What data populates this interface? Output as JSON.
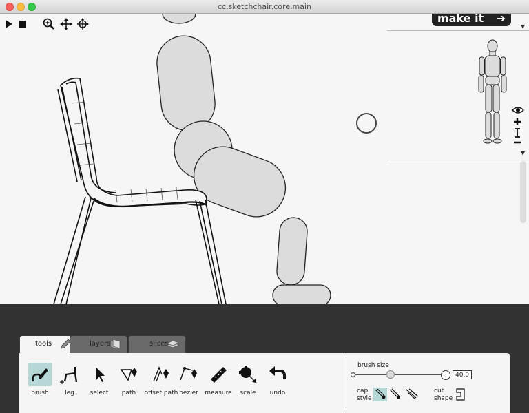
{
  "window": {
    "title": "cc.sketchchair.core.main"
  },
  "toolbar": {
    "play_icon": "play-icon",
    "stop_icon": "stop-icon",
    "zoom_icon": "zoom-icon",
    "pan_icon": "move-icon",
    "rotate_icon": "rotate-icon",
    "make_it_label": "make it",
    "make_it_arrow": "➔"
  },
  "tabs": [
    {
      "label": "tools",
      "icon": "pencil-icon",
      "active": true
    },
    {
      "label": "layers",
      "icon": "layers-icon",
      "active": false
    },
    {
      "label": "slices",
      "icon": "slices-icon",
      "active": false
    }
  ],
  "tools": [
    {
      "label": "brush",
      "icon": "brush-icon",
      "active": true
    },
    {
      "label": "leg",
      "icon": "leg-icon",
      "active": false
    },
    {
      "label": "select",
      "icon": "select-icon",
      "active": false
    },
    {
      "label": "path",
      "icon": "path-icon",
      "active": false
    },
    {
      "label": "offset path",
      "icon": "offset-path-icon",
      "active": false
    },
    {
      "label": "bezier",
      "icon": "bezier-icon",
      "active": false
    },
    {
      "label": "measure",
      "icon": "measure-icon",
      "active": false
    },
    {
      "label": "scale",
      "icon": "scale-icon",
      "active": false
    },
    {
      "label": "undo",
      "icon": "undo-icon",
      "active": false
    }
  ],
  "brush": {
    "size_label": "brush size",
    "size_value": "40.0",
    "size_fraction": 0.42,
    "cap_label_1": "cap",
    "cap_label_2": "style",
    "cut_label_1": "cut",
    "cut_label_2": "shape"
  },
  "colors": {
    "accent": "#b5d8d6",
    "dark_bar": "#323232",
    "figure_fill": "#dcdcdc"
  }
}
